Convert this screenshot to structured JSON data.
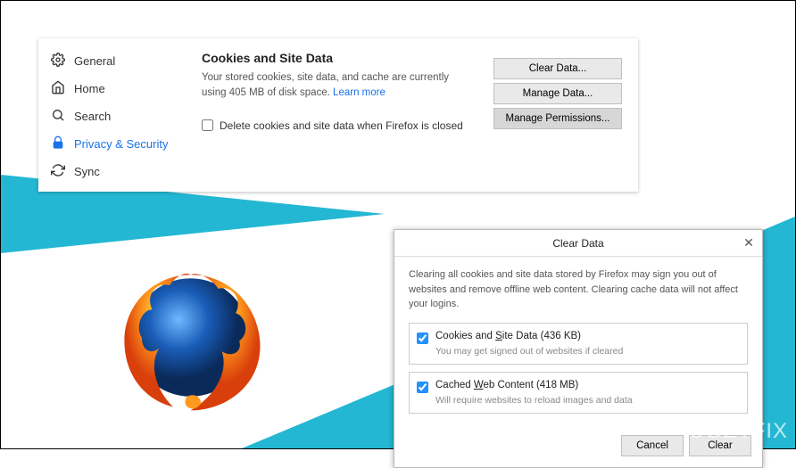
{
  "sidebar": {
    "items": [
      {
        "label": "General"
      },
      {
        "label": "Home"
      },
      {
        "label": "Search"
      },
      {
        "label": "Privacy & Security"
      },
      {
        "label": "Sync"
      }
    ]
  },
  "settings": {
    "section_title": "Cookies and Site Data",
    "description_pre": "Your stored cookies, site data, and cache are currently using ",
    "description_size": "405 MB",
    "description_post": " of disk space.  ",
    "learn_more": "Learn more",
    "checkbox_label": "Delete cookies and site data when Firefox is closed",
    "buttons": {
      "clear_data": "Clear Data...",
      "manage_data": "Manage Data...",
      "manage_permissions": "Manage Permissions..."
    }
  },
  "dialog": {
    "title": "Clear Data",
    "close_glyph": "✕",
    "description": "Clearing all cookies and site data stored by Firefox may sign you out of websites and remove offline web content. Clearing cache data will not affect your logins.",
    "options": [
      {
        "label_pre": "Cookies and ",
        "label_underline": "S",
        "label_post": "ite Data (436 KB)",
        "sub": "You may get signed out of websites if cleared",
        "checked": true
      },
      {
        "label_pre": "Cached ",
        "label_underline": "W",
        "label_post": "eb Content (418 MB)",
        "sub": "Will require websites to reload images and data",
        "checked": true
      }
    ],
    "cancel": "Cancel",
    "clear": "Clear"
  },
  "watermark": "UGETFIX"
}
